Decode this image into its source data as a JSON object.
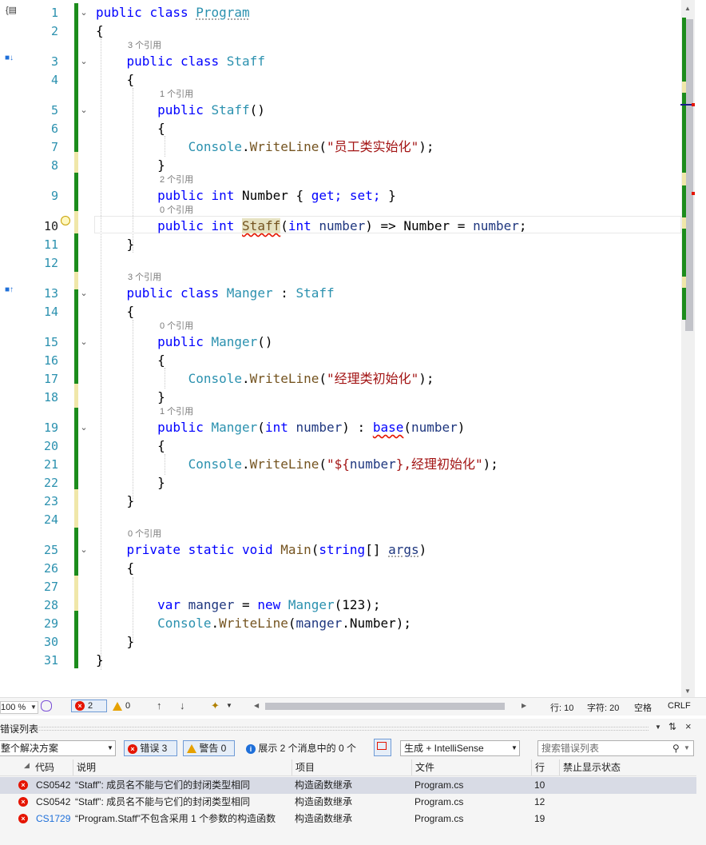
{
  "editor": {
    "line_numbers": [
      "1",
      "2",
      "3",
      "4",
      "5",
      "6",
      "7",
      "8",
      "9",
      "10",
      "11",
      "12",
      "13",
      "14",
      "15",
      "16",
      "17",
      "18",
      "19",
      "20",
      "21",
      "22",
      "23",
      "24",
      "25",
      "26",
      "27",
      "28",
      "29",
      "30",
      "31"
    ],
    "codelens": {
      "staff_class": "3 个引用",
      "staff_ctor": "1 个引用",
      "number_prop": "2 个引用",
      "staff_method": "0 个引用",
      "manger_class": "3 个引用",
      "manger_ctor": "0 个引用",
      "manger_ctor2": "1 个引用",
      "main": "0 个引用"
    },
    "tokens": {
      "public": "public",
      "class": "class",
      "private": "private",
      "static": "static",
      "void": "void",
      "int": "int",
      "string": "string",
      "var": "var",
      "new": "new",
      "base": "base",
      "get": "get;",
      "set": "set;",
      "Program": "Program",
      "Staff": "Staff",
      "Manger": "Manger",
      "Console": "Console",
      "WriteLine": "WriteLine",
      "Number": "Number",
      "Main": "Main",
      "number": "number",
      "args": "args",
      "manger": "manger",
      "str_staff": "\"员工类实始化\"",
      "str_manger": "\"经理类初始化\"",
      "str_interp_open": "\"${",
      "str_interp_close": "},经理初始化\"",
      "lit_123": "123"
    }
  },
  "status_strip": {
    "zoom": "100 %",
    "errors": "2",
    "warnings": "0",
    "line": "行: 10",
    "col": "字符: 20",
    "space": "空格",
    "eol": "CRLF"
  },
  "error_list": {
    "title": "错误列表",
    "scope": "整个解决方案",
    "errors_btn": "错误 3",
    "warnings_btn": "警告 0",
    "messages_btn": "展示 2 个消息中的 0 个",
    "build_filter": "生成 + IntelliSense",
    "search_placeholder": "搜索错误列表",
    "columns": {
      "code": "代码",
      "desc": "说明",
      "project": "项目",
      "file": "文件",
      "line": "行",
      "suppress": "禁止显示状态"
    },
    "rows": [
      {
        "code": "CS0542",
        "desc": "“Staff”: 成员名不能与它们的封闭类型相同",
        "project": "构造函数继承",
        "file": "Program.cs",
        "line": "10"
      },
      {
        "code": "CS0542",
        "desc": "“Staff”: 成员名不能与它们的封闭类型相同",
        "project": "构造函数继承",
        "file": "Program.cs",
        "line": "12"
      },
      {
        "code": "CS1729",
        "desc": "“Program.Staff”不包含采用 1 个参数的构造函数",
        "project": "构造函数继承",
        "file": "Program.cs",
        "line": "19"
      }
    ]
  },
  "colors": {
    "keyword": "#0000ff",
    "type": "#2b91af",
    "method": "#74531f",
    "string": "#a31515",
    "error": "#e51400",
    "changed_green": "#1c8c1c"
  }
}
